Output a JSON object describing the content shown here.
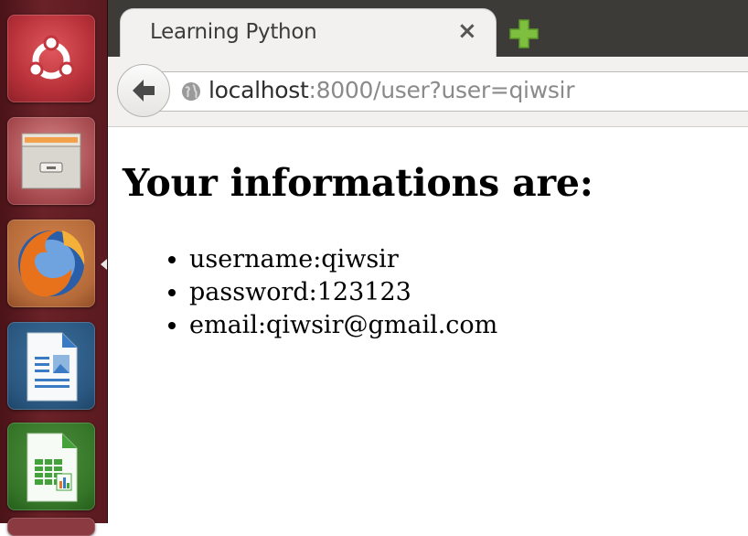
{
  "launcher": {
    "items": [
      {
        "name": "ubuntu-dash",
        "icon": "ubuntu-logo-icon"
      },
      {
        "name": "files",
        "icon": "file-cabinet-icon"
      },
      {
        "name": "firefox",
        "icon": "firefox-icon",
        "active": true
      },
      {
        "name": "libreoffice-writer",
        "icon": "writer-document-icon"
      },
      {
        "name": "libreoffice-calc",
        "icon": "calc-spreadsheet-icon"
      }
    ]
  },
  "browser": {
    "tab": {
      "title": "Learning Python",
      "close_symbol": "×"
    },
    "new_tab_icon": "plus-icon",
    "address": {
      "host": "localhost",
      "rest": ":8000/user?user=qiwsir"
    }
  },
  "page": {
    "heading": "Your informations are:",
    "items": [
      "username:qiwsir",
      "password:123123",
      "email:qiwsir@gmail.com"
    ]
  },
  "colors": {
    "launcher_bg": "#5a1a1f",
    "tabbar_bg": "#3c3b37",
    "tab_bg": "#f2f1f0",
    "new_tab_green": "#7fbf3f"
  }
}
